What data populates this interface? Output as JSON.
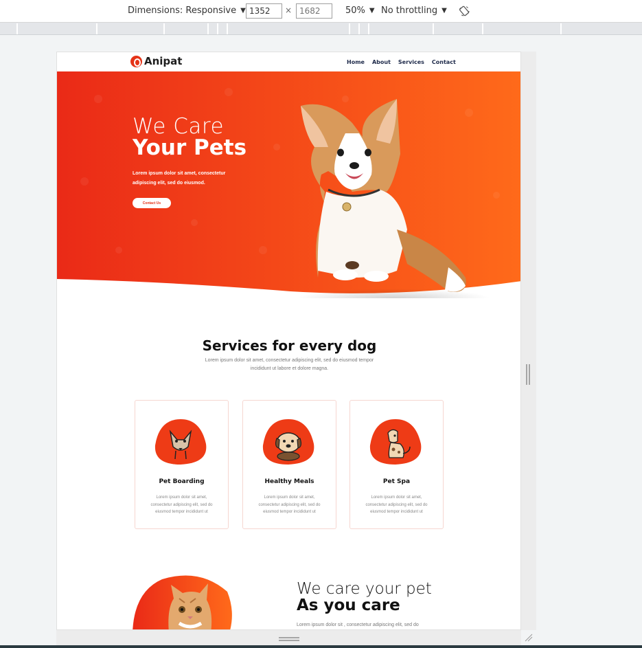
{
  "devtools": {
    "dimensions_label": "Dimensions: Responsive",
    "width_value": "1352",
    "height_placeholder": "1682",
    "times": "×",
    "zoom": "50%",
    "throttling": "No throttling"
  },
  "site": {
    "brand": "Anipat",
    "nav": [
      "Home",
      "About",
      "Services",
      "Contact"
    ],
    "hero": {
      "title_line1": "We Care",
      "title_line2": "Your Pets",
      "text": "Lorem ipsum dolor sit amet, consectetur adipiscing elit, sed do eiusmod.",
      "button": "Contact Us"
    },
    "services": {
      "title": "Services for every dog",
      "subtitle": "Lorem ipsum dolor sit amet, consectetur adipiscing elit, sed do eiusmod tempor incididunt ut labore et dolore magna.",
      "cards": [
        {
          "title": "Pet Boarding",
          "text": "Lorem ipsum dolor sit amet, consectetur adipiscing elit, sed do eiusmod tempor incididunt ut",
          "icon": "chihuahua-icon"
        },
        {
          "title": "Healthy Meals",
          "text": "Lorem ipsum dolor sit amet, consectetur adipiscing elit, sed do eiusmod tempor incididunt ut",
          "icon": "puppy-icon"
        },
        {
          "title": "Pet Spa",
          "text": "Lorem ipsum dolor sit amet, consectetur adipiscing elit, sed do eiusmod tempor incididunt ut",
          "icon": "spotted-dog-icon"
        }
      ]
    },
    "care": {
      "title_line1": "We care your pet",
      "title_line2": "As you care",
      "text": "Lorem ipsum dolor sit , consectetur adipiscing elit, sed do"
    }
  },
  "colors": {
    "brand_red": "#e53317",
    "brand_orange": "#ff6a1a"
  }
}
